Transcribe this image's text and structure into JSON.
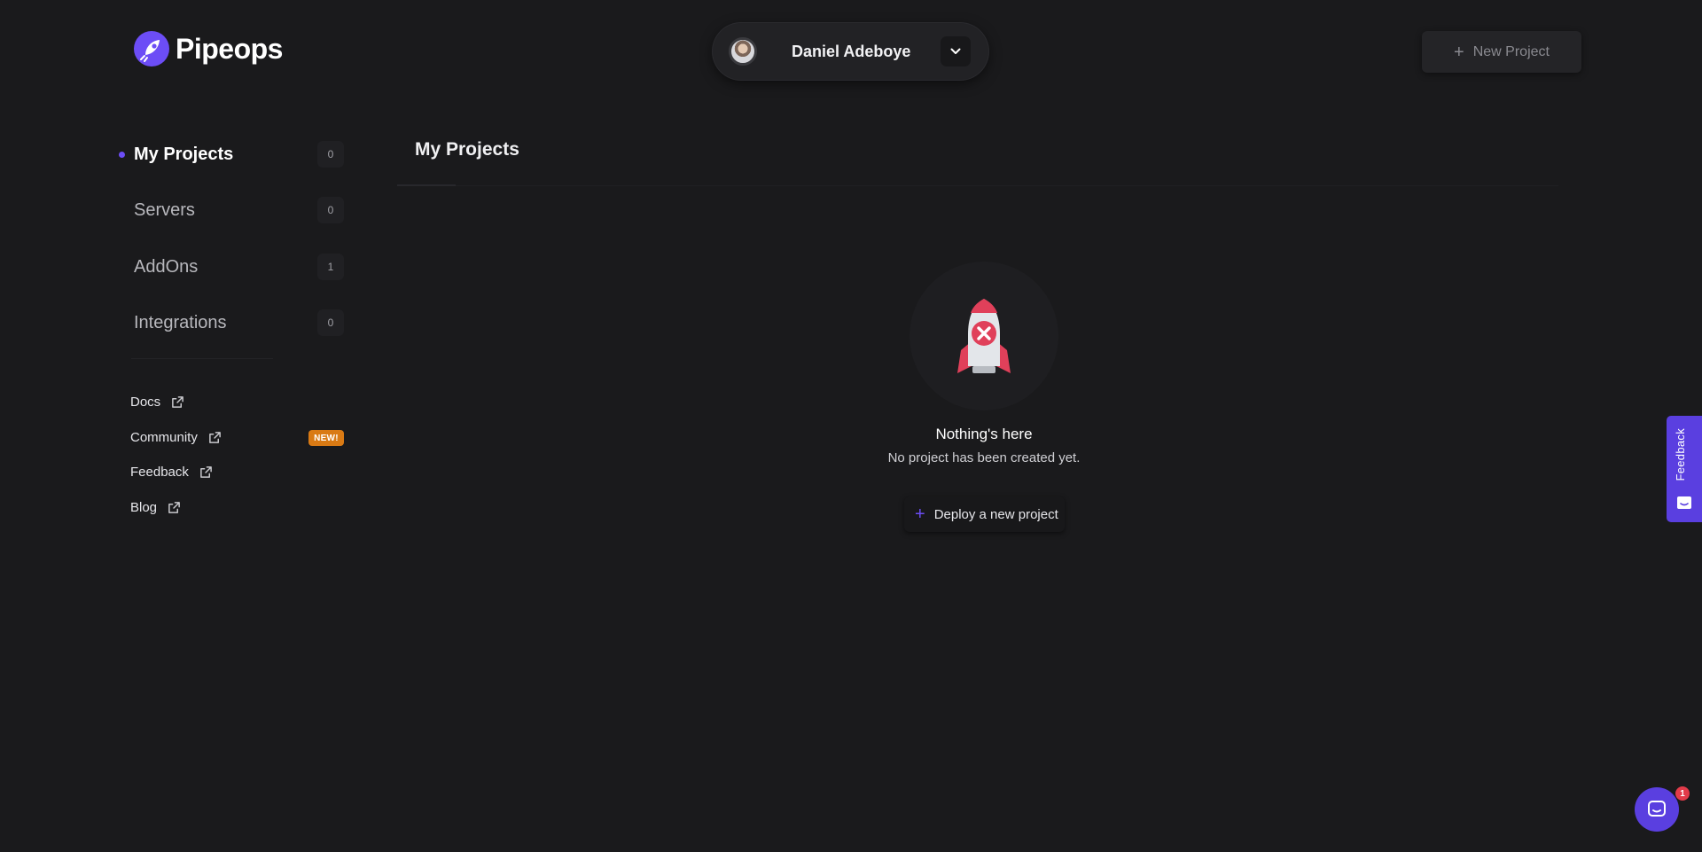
{
  "header": {
    "logo_text": "Pipeops",
    "user_name": "Daniel Adeboye",
    "new_project_label": "New Project"
  },
  "sidebar": {
    "items": [
      {
        "label": "My Projects",
        "count": "0",
        "active": true
      },
      {
        "label": "Servers",
        "count": "0",
        "active": false
      },
      {
        "label": "AddOns",
        "count": "1",
        "active": false
      },
      {
        "label": "Integrations",
        "count": "0",
        "active": false
      }
    ],
    "links": [
      {
        "label": "Docs"
      },
      {
        "label": "Community",
        "badge": "NEW!"
      },
      {
        "label": "Feedback"
      },
      {
        "label": "Blog"
      }
    ]
  },
  "main": {
    "title": "My Projects",
    "empty_title": "Nothing's here",
    "empty_subtitle": "No project has been created yet.",
    "deploy_label": "Deploy a new project"
  },
  "feedback_tab": {
    "label": "Feedback"
  },
  "chat": {
    "badge_count": "1"
  },
  "colors": {
    "background": "#1a1a1c",
    "accent": "#6c4df6",
    "badge_orange": "#d97a14",
    "rocket_red": "#e0405a"
  },
  "icons": {
    "logo": "rocket-logo-icon",
    "chevron": "chevron-down-icon",
    "plus": "plus-icon",
    "external_link": "external-link-icon",
    "empty_state": "rocket-error-icon",
    "chat": "chat-bubble-icon"
  }
}
